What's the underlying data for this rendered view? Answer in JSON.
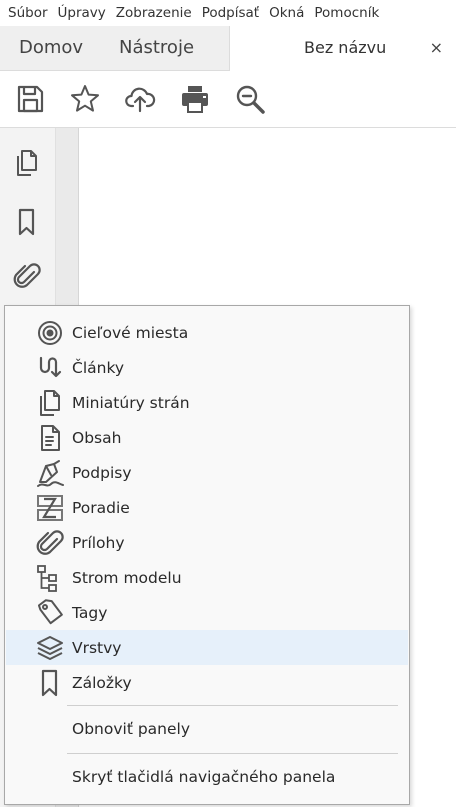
{
  "menubar": {
    "items": [
      "Súbor",
      "Úpravy",
      "Zobrazenie",
      "Podpísať",
      "Okná",
      "Pomocník"
    ]
  },
  "tabs": {
    "home": "Domov",
    "tools": "Nástroje",
    "document": "Bez názvu",
    "close": "×"
  },
  "toolbar": {
    "icons": [
      "save-icon",
      "star-icon",
      "cloud-upload-icon",
      "print-icon",
      "zoom-icon"
    ]
  },
  "leftrail": {
    "icons": [
      "page-thumbnails-icon",
      "bookmark-icon",
      "attachment-icon"
    ]
  },
  "popup": {
    "items": [
      {
        "label": "Cieľové miesta",
        "icon": "target-icon"
      },
      {
        "label": "Články",
        "icon": "articles-icon"
      },
      {
        "label": "Miniatúry strán",
        "icon": "page-thumbnails-icon"
      },
      {
        "label": "Obsah",
        "icon": "content-icon"
      },
      {
        "label": "Podpisy",
        "icon": "signature-pen-icon"
      },
      {
        "label": "Poradie",
        "icon": "order-icon"
      },
      {
        "label": "Prílohy",
        "icon": "attachment-icon"
      },
      {
        "label": "Strom modelu",
        "icon": "model-tree-icon"
      },
      {
        "label": "Tagy",
        "icon": "tag-icon"
      },
      {
        "label": "Vrstvy",
        "icon": "layers-icon"
      },
      {
        "label": "Záložky",
        "icon": "bookmark-icon"
      }
    ],
    "highlighted": "Vrstvy",
    "reset_panels": "Obnoviť panely",
    "hide_nav_buttons": "Skryť tlačidlá navigačného panela"
  },
  "colors": {
    "highlight": "#e6f0fa",
    "icon": "#555555"
  }
}
